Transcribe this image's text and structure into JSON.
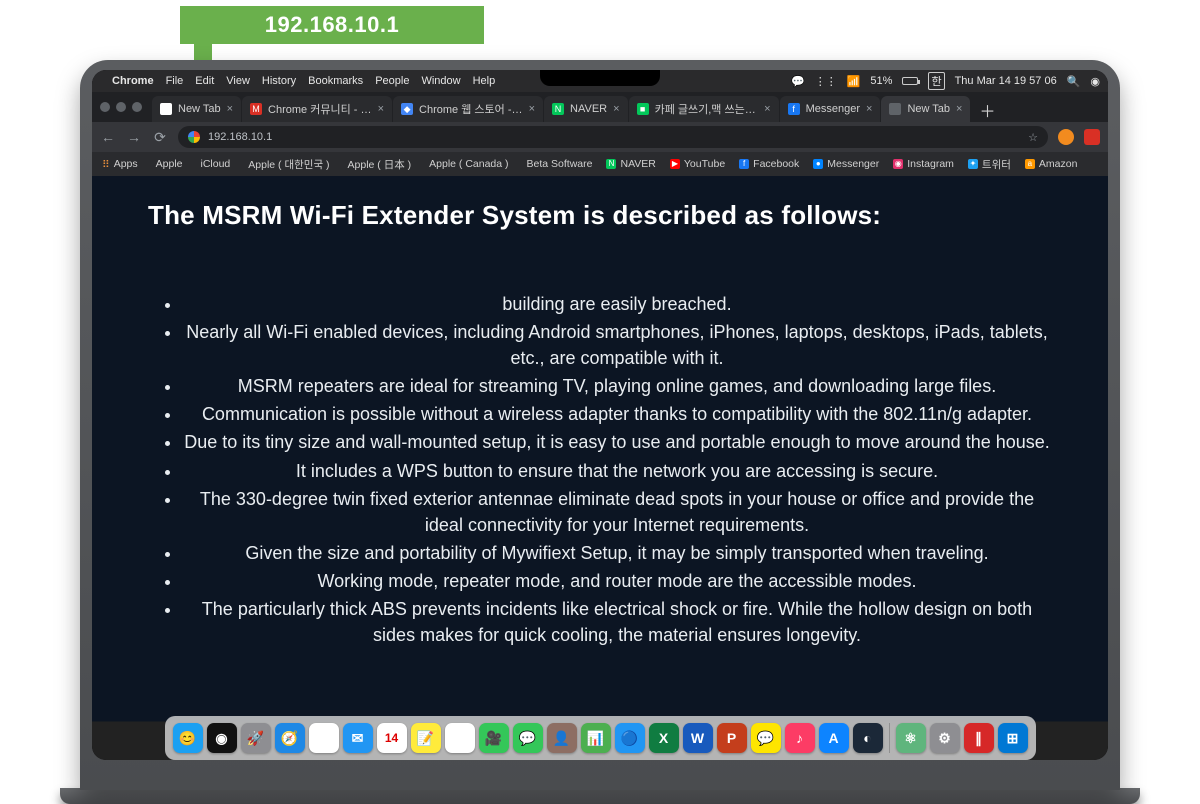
{
  "ip_label": "192.168.10.1",
  "menubar": {
    "app": "Chrome",
    "items": [
      "File",
      "Edit",
      "View",
      "History",
      "Bookmarks",
      "People",
      "Window",
      "Help"
    ],
    "battery": "51%",
    "lang": "한",
    "clock": "Thu Mar 14  19 57 06"
  },
  "tabs": [
    {
      "title": "New Tab",
      "fav_bg": "#fff",
      "fav_txt": "G"
    },
    {
      "title": "Chrome 커뮤니티 - 'N…",
      "fav_bg": "#d93025",
      "fav_txt": "M"
    },
    {
      "title": "Chrome 웹 스토어 - In…",
      "fav_bg": "#4285f4",
      "fav_txt": "◆"
    },
    {
      "title": "NAVER",
      "fav_bg": "#03c75a",
      "fav_txt": "N"
    },
    {
      "title": "카페 글쓰기,맥 쓰는 사람…",
      "fav_bg": "#03c75a",
      "fav_txt": "■"
    },
    {
      "title": "Messenger",
      "fav_bg": "#1877f2",
      "fav_txt": "f"
    },
    {
      "title": "New Tab",
      "fav_bg": "#5f6368",
      "fav_txt": ""
    }
  ],
  "active_tab_index": 6,
  "address": "192.168.10.1",
  "bookmarks": [
    {
      "label": "Apps",
      "color": "#ea8f3c",
      "glyph": "⋮⋮⋮"
    },
    {
      "label": "Apple",
      "color": "#bbb",
      "glyph": ""
    },
    {
      "label": "iCloud",
      "color": "#bbb",
      "glyph": ""
    },
    {
      "label": "Apple ( 대한민국 )",
      "color": "#bbb",
      "glyph": ""
    },
    {
      "label": "Apple ( 日本 )",
      "color": "#bbb",
      "glyph": ""
    },
    {
      "label": "Apple ( Canada )",
      "color": "#bbb",
      "glyph": ""
    },
    {
      "label": "Beta Software",
      "color": "#bbb",
      "glyph": ""
    },
    {
      "label": "NAVER",
      "color": "#03c75a",
      "glyph": "N"
    },
    {
      "label": "YouTube",
      "color": "#ff0000",
      "glyph": "▶"
    },
    {
      "label": "Facebook",
      "color": "#1877f2",
      "glyph": "f"
    },
    {
      "label": "Messenger",
      "color": "#0084ff",
      "glyph": "●"
    },
    {
      "label": "Instagram",
      "color": "#e1306c",
      "glyph": "◉"
    },
    {
      "label": "트위터",
      "color": "#1da1f2",
      "glyph": "✦"
    },
    {
      "label": "Amazon",
      "color": "#ff9900",
      "glyph": "a"
    }
  ],
  "page": {
    "heading": "The MSRM Wi-Fi Extender System is described as follows:",
    "bullets": [
      "building are easily breached.",
      "Nearly all Wi-Fi enabled devices, including Android smartphones, iPhones, laptops, desktops, iPads, tablets, etc., are compatible with it.",
      "MSRM repeaters are ideal for streaming TV, playing online games, and downloading large files.",
      "Communication is possible without a wireless adapter thanks to compatibility with the 802.11n/g adapter.",
      "Due to its tiny size and wall-mounted setup, it is easy to use and portable enough to move around the house.",
      "It includes a WPS button to ensure that the network you are accessing is secure.",
      "The 330-degree twin fixed exterior antennae eliminate dead spots in your house or office and provide the ideal connectivity for your Internet requirements.",
      "Given the size and portability of Mywifiext Setup, it may be simply transported when traveling.",
      "Working mode, repeater mode, and router mode are the accessible modes.",
      "The particularly thick ABS prevents incidents like electrical shock or fire. While the hollow design on both sides makes for quick cooling, the material ensures longevity."
    ]
  },
  "dock": [
    {
      "name": "finder",
      "bg": "#1ba0f2",
      "glyph": "😊"
    },
    {
      "name": "siri",
      "bg": "#111",
      "glyph": "◉"
    },
    {
      "name": "launchpad",
      "bg": "#8e8e92",
      "glyph": "🚀"
    },
    {
      "name": "safari",
      "bg": "#1e88e5",
      "glyph": "🧭"
    },
    {
      "name": "chrome",
      "bg": "#fff",
      "glyph": "◎"
    },
    {
      "name": "mail",
      "bg": "#2196f3",
      "glyph": "✉"
    },
    {
      "name": "calendar",
      "bg": "#fff",
      "glyph": "14"
    },
    {
      "name": "notes",
      "bg": "#ffeb3b",
      "glyph": "📝"
    },
    {
      "name": "photos",
      "bg": "#fff",
      "glyph": "✿"
    },
    {
      "name": "facetime",
      "bg": "#34c759",
      "glyph": "🎥"
    },
    {
      "name": "messages",
      "bg": "#34c759",
      "glyph": "💬"
    },
    {
      "name": "contacts",
      "bg": "#8d6e63",
      "glyph": "👤"
    },
    {
      "name": "numbers",
      "bg": "#4caf50",
      "glyph": "📊"
    },
    {
      "name": "keynote",
      "bg": "#2196f3",
      "glyph": "🔵"
    },
    {
      "name": "excel",
      "bg": "#107c41",
      "glyph": "X"
    },
    {
      "name": "word",
      "bg": "#185abd",
      "glyph": "W"
    },
    {
      "name": "powerpoint",
      "bg": "#c43e1c",
      "glyph": "P"
    },
    {
      "name": "kakaotalk",
      "bg": "#fee500",
      "glyph": "💬"
    },
    {
      "name": "itunes",
      "bg": "#fc3c65",
      "glyph": "♪"
    },
    {
      "name": "appstore",
      "bg": "#0d84ff",
      "glyph": "A"
    },
    {
      "name": "steam",
      "bg": "#1b2838",
      "glyph": "◐"
    },
    {
      "name": "atom",
      "bg": "#5fb57d",
      "glyph": "⚛"
    },
    {
      "name": "system-prefs",
      "bg": "#8e8e92",
      "glyph": "⚙"
    },
    {
      "name": "parallels",
      "bg": "#d62828",
      "glyph": "∥"
    },
    {
      "name": "windows",
      "bg": "#0078d4",
      "glyph": "⊞"
    }
  ]
}
